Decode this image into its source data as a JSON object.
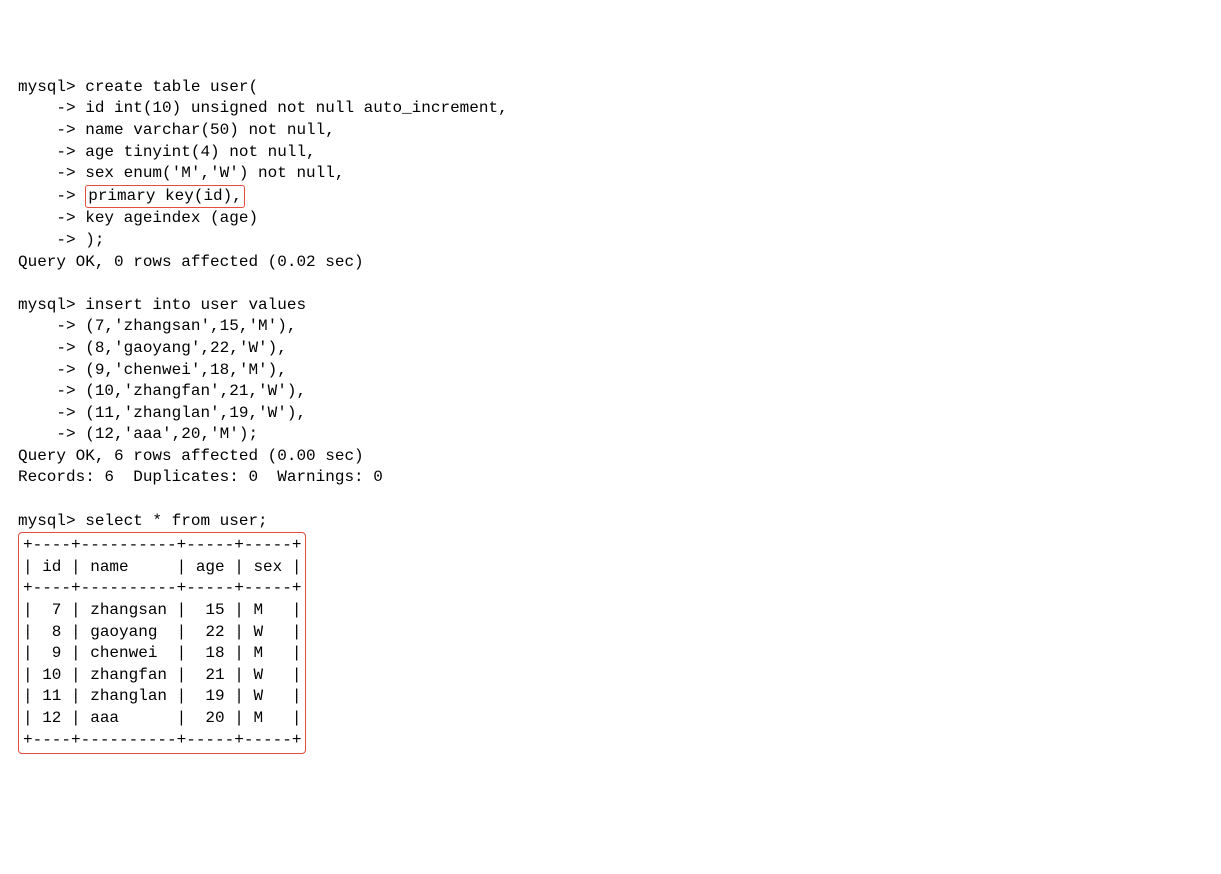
{
  "create_block": {
    "prompt": "mysql> ",
    "cont": "    -> ",
    "stmt": "create table user(",
    "lines": [
      "id int(10) unsigned not null auto_increment,",
      "name varchar(50) not null,",
      "age tinyint(4) not null,",
      "sex enum('M','W') not null,"
    ],
    "pk_line": "primary key(id),",
    "after_pk": [
      "key ageindex (age)",
      ");"
    ],
    "result": "Query OK, 0 rows affected (0.02 sec)"
  },
  "insert_block": {
    "prompt": "mysql> ",
    "cont": "    -> ",
    "stmt": "insert into user values",
    "lines": [
      "(7,'zhangsan',15,'M'),",
      "(8,'gaoyang',22,'W'),",
      "(9,'chenwei',18,'M'),",
      "(10,'zhangfan',21,'W'),",
      "(11,'zhanglan',19,'W'),",
      "(12,'aaa',20,'M');"
    ],
    "result1": "Query OK, 6 rows affected (0.00 sec)",
    "result2": "Records: 6  Duplicates: 0  Warnings: 0"
  },
  "select_block": {
    "prompt": "mysql> ",
    "stmt": "select * from user;",
    "table_lines": [
      "+----+----------+-----+-----+",
      "| id | name     | age | sex |",
      "+----+----------+-----+-----+",
      "|  7 | zhangsan |  15 | M   |",
      "|  8 | gaoyang  |  22 | W   |",
      "|  9 | chenwei  |  18 | M   |",
      "| 10 | zhangfan |  21 | W   |",
      "| 11 | zhanglan |  19 | W   |",
      "| 12 | aaa      |  20 | M   |",
      "+----+----------+-----+-----+"
    ]
  },
  "chart_data": {
    "type": "table",
    "title": "user",
    "columns": [
      "id",
      "name",
      "age",
      "sex"
    ],
    "rows": [
      [
        7,
        "zhangsan",
        15,
        "M"
      ],
      [
        8,
        "gaoyang",
        22,
        "W"
      ],
      [
        9,
        "chenwei",
        18,
        "M"
      ],
      [
        10,
        "zhangfan",
        21,
        "W"
      ],
      [
        11,
        "zhanglan",
        19,
        "W"
      ],
      [
        12,
        "aaa",
        20,
        "M"
      ]
    ]
  }
}
